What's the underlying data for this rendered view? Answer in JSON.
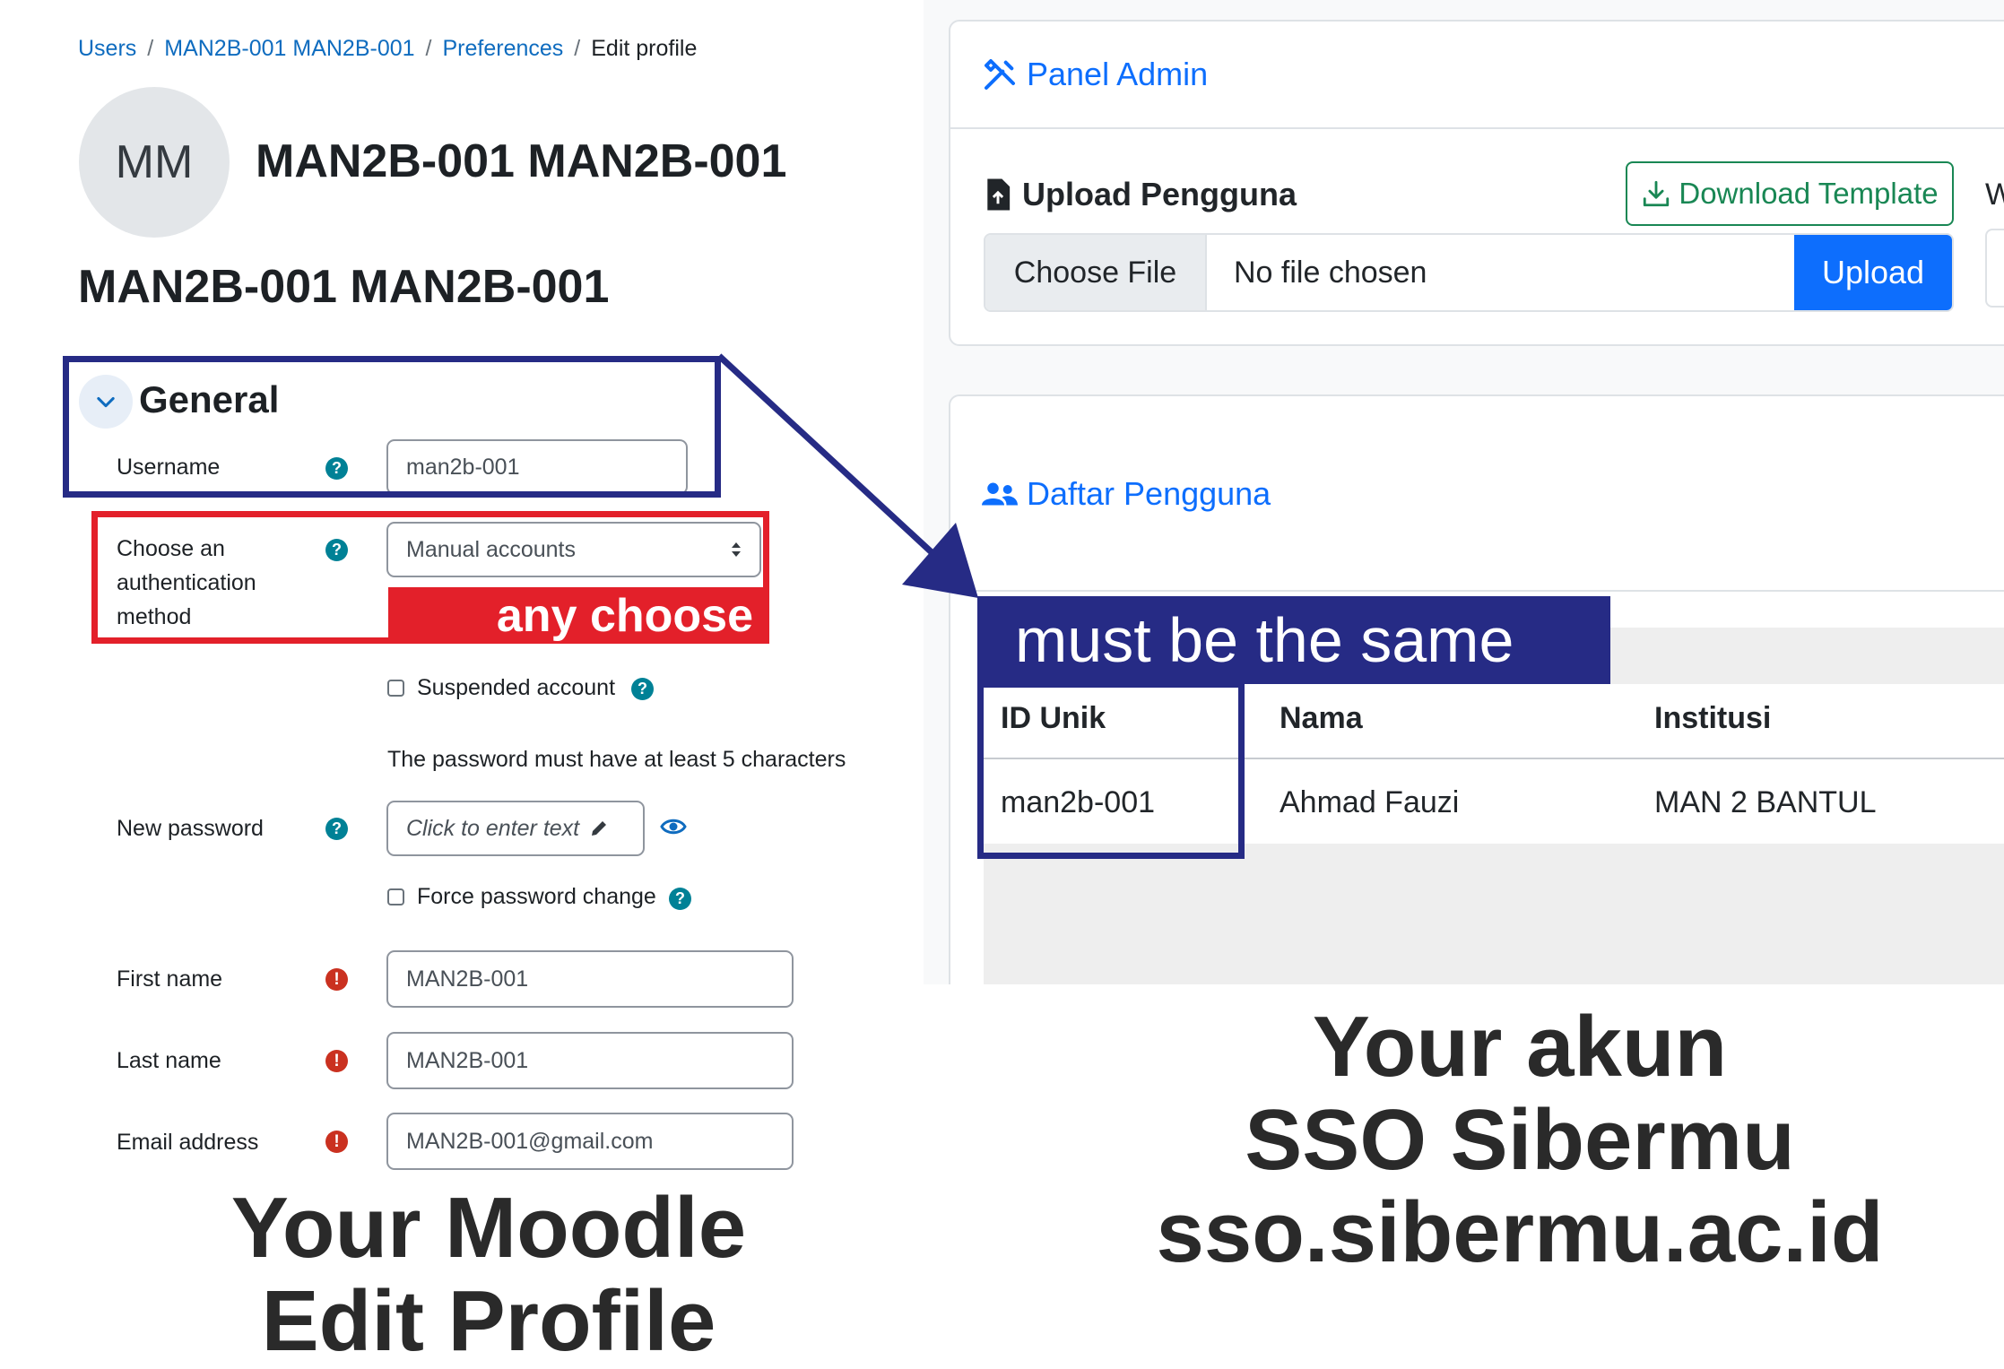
{
  "moodle": {
    "breadcrumb": [
      "Users",
      "MAN2B-001 MAN2B-001",
      "Preferences",
      "Edit profile"
    ],
    "avatar_initials": "MM",
    "profile_name": "MAN2B-001 MAN2B-001",
    "page_heading": "MAN2B-001 MAN2B-001",
    "section_title": "General",
    "username_label": "Username",
    "username_value": "man2b-001",
    "auth_label_1": "Choose an",
    "auth_label_2": "authentication",
    "auth_label_3": "method",
    "auth_value": "Manual accounts",
    "suspended_label": "Suspended account",
    "password_hint": "The password must have at least 5 characters",
    "new_password_label": "New password",
    "new_password_placeholder": "Click to enter text",
    "force_change_label": "Force password change",
    "first_name_label": "First name",
    "first_name_value": "MAN2B-001",
    "last_name_label": "Last name",
    "last_name_value": "MAN2B-001",
    "email_label": "Email address",
    "email_value": "MAN2B-001@gmail.com"
  },
  "annotations": {
    "any_choose": "any choose",
    "must_be_same": "must be the same",
    "moodle_caption_1": "Your Moodle",
    "moodle_caption_2": "Edit Profile",
    "sso_caption_1": "Your akun",
    "sso_caption_2": "SSO Sibermu",
    "sso_caption_3": "sso.sibermu.ac.id",
    "annotation_color": "#262b85",
    "highlight_color": "#e3202a"
  },
  "sso": {
    "panel_title": "Panel Admin",
    "upload_title": "Upload Pengguna",
    "download_template": "Download Template",
    "cut_off_char": "W",
    "choose_file": "Choose File",
    "no_file": "No file chosen",
    "upload_button": "Upload",
    "list_title": "Daftar Pengguna",
    "table_headers": [
      "ID Unik",
      "Nama",
      "Institusi"
    ],
    "table_rows": [
      [
        "man2b-001",
        "Ahmad Fauzi",
        "MAN 2 BANTUL"
      ]
    ],
    "primary_color": "#0d6efd",
    "success_color": "#198754"
  }
}
